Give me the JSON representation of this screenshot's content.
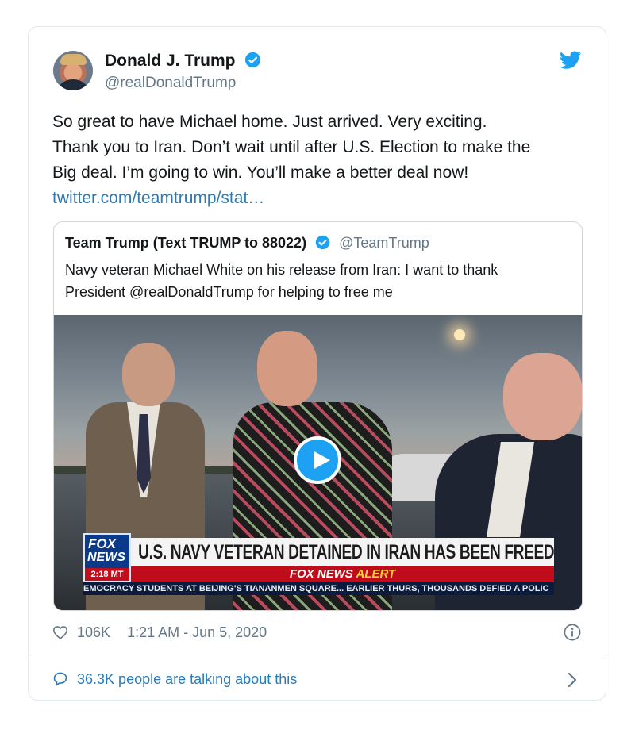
{
  "tweet": {
    "author_name": "Donald J. Trump",
    "author_handle": "@realDonaldTrump",
    "text_lines": [
      "So great to have Michael home. Just arrived. Very exciting.",
      "Thank you to Iran. Don’t wait until after U.S. Election to make the",
      "Big deal. I’m going to win. You’ll make a better deal now!"
    ],
    "link": "twitter.com/teamtrump/stat…",
    "icons": {
      "verified": "verified-badge-icon",
      "brand": "twitter-bird-icon"
    }
  },
  "quote": {
    "author_name": "Team Trump (Text TRUMP to 88022)",
    "author_handle": "@TeamTrump",
    "text_lines": [
      "Navy veteran Michael White on his release from Iran: I want to thank",
      "President @realDonaldTrump for helping to free me"
    ],
    "video": {
      "logo_line1": "FOX",
      "logo_line2": "NEWS",
      "logo_time": "2:18 MT",
      "headline": "U.S. NAVY VETERAN DETAINED IN IRAN HAS BEEN FREED",
      "alert_prefix": "FOX NEWS",
      "alert_word": "ALERT",
      "ticker": "EMOCRACY STUDENTS AT BEIJING'S TIANANMEN SQUARE...   EARLIER THURS, THOUSANDS DEFIED A POLIC"
    }
  },
  "meta": {
    "likes": "106K",
    "timestamp": "1:21 AM - Jun 5, 2020"
  },
  "footer": {
    "conversation": "36.3K people are talking about this"
  },
  "colors": {
    "accent": "#1da1f2",
    "link": "#2b7bb9",
    "muted": "#657786",
    "fox_red": "#c20d1b",
    "fox_blue": "#0c3a8a"
  }
}
